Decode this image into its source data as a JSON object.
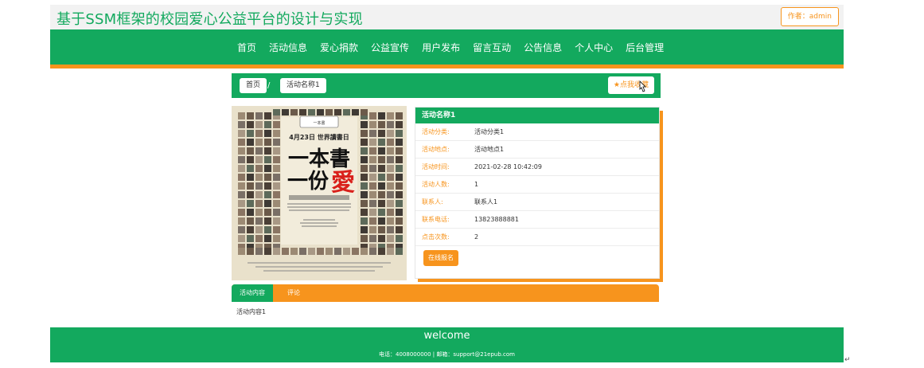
{
  "header": {
    "title": "基于SSM框架的校园爱心公益平台的设计与实现",
    "author_label": "作者：admin"
  },
  "nav": {
    "items": [
      "首页",
      "活动信息",
      "爱心捐款",
      "公益宣传",
      "用户发布",
      "留言互动",
      "公告信息",
      "个人中心",
      "后台管理"
    ]
  },
  "breadcrumb": {
    "home": "首页",
    "separator": "/",
    "current": "活动名称1",
    "favorite_label": "点我收藏"
  },
  "detail": {
    "title": "活动名称1",
    "rows": [
      {
        "label": "活动分类:",
        "value": "活动分类1"
      },
      {
        "label": "活动地点:",
        "value": "活动地点1"
      },
      {
        "label": "活动时间:",
        "value": "2021-02-28 10:42:09"
      },
      {
        "label": "活动人数:",
        "value": "1"
      },
      {
        "label": "联系人:",
        "value": "联系人1"
      },
      {
        "label": "联系电话:",
        "value": "13823888881"
      },
      {
        "label": "点击次数:",
        "value": "2"
      }
    ],
    "signup_label": "在线报名"
  },
  "poster": {
    "date_text": "4月23日 世界讀書日",
    "line1": "一本書",
    "line2a": "一份",
    "line2b": "愛"
  },
  "tabs": {
    "items": [
      "活动内容",
      "评论"
    ]
  },
  "content": {
    "text": "活动内容1"
  },
  "footer": {
    "title": "welcome",
    "contact": "电话：4008000000 | 邮箱：support@21epub.com"
  },
  "colors": {
    "green": "#13a95e",
    "orange": "#f7941d"
  }
}
